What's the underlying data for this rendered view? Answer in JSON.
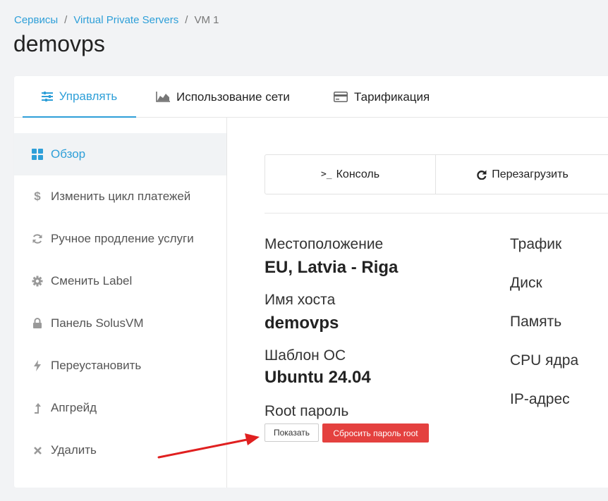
{
  "breadcrumb": {
    "items": [
      "Сервисы",
      "Virtual Private Servers"
    ],
    "current": "VM 1",
    "separator": "/"
  },
  "page_title": "demovps",
  "tabs": [
    {
      "label": "Управлять",
      "icon": "sliders-icon",
      "active": true
    },
    {
      "label": "Использование сети",
      "icon": "area-chart-icon"
    },
    {
      "label": "Тарификация",
      "icon": "credit-card-icon"
    }
  ],
  "sidebar": {
    "items": [
      {
        "label": "Обзор",
        "icon": "grid-icon",
        "active": true
      },
      {
        "label": "Изменить цикл платежей",
        "icon": "dollar-icon"
      },
      {
        "label": "Ручное продление услуги",
        "icon": "refresh-icon"
      },
      {
        "label": "Сменить Label",
        "icon": "gear-icon"
      },
      {
        "label": "Панель SolusVM",
        "icon": "lock-icon"
      },
      {
        "label": "Переустановить",
        "icon": "bolt-icon"
      },
      {
        "label": "Апгрейд",
        "icon": "level-up-icon"
      },
      {
        "label": "Удалить",
        "icon": "close-icon"
      }
    ]
  },
  "actions": {
    "console": {
      "prompt": ">_",
      "label": "Консоль"
    },
    "reboot": {
      "label": "Перезагрузить",
      "icon": "redo-icon"
    }
  },
  "details": {
    "location": {
      "label": "Местоположение",
      "value": "EU, Latvia - Riga"
    },
    "hostname": {
      "label": "Имя хоста",
      "value": "demovps"
    },
    "os": {
      "label": "Шаблон ОС",
      "value": "Ubuntu 24.04"
    },
    "root_password": {
      "label": "Root пароль"
    }
  },
  "right_details": [
    "Трафик",
    "Диск",
    "Память",
    "CPU ядра",
    "IP-адрес"
  ],
  "buttons": {
    "show": "Показать",
    "reset": "Сбросить пароль root"
  },
  "colors": {
    "accent": "#2e9fd8",
    "danger": "#e4413f",
    "arrow": "#e02020"
  }
}
